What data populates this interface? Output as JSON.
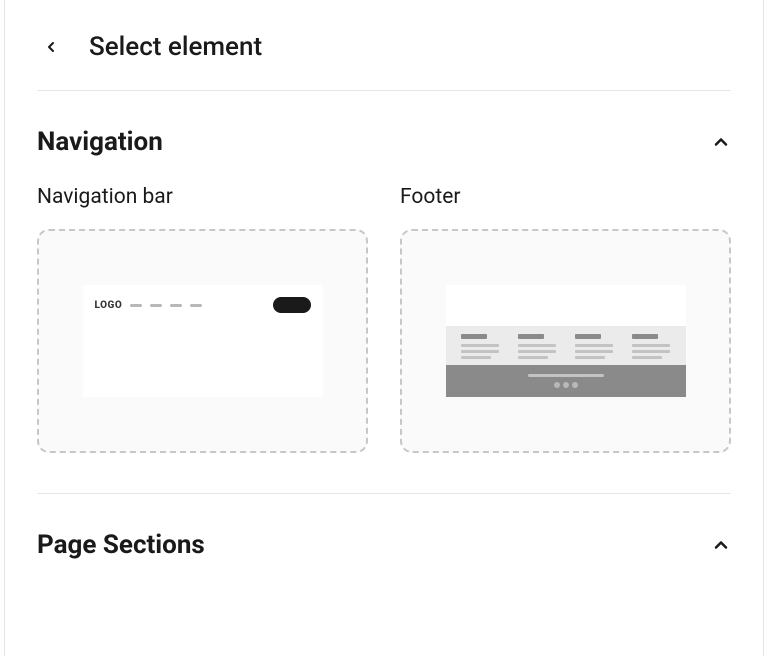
{
  "header": {
    "title": "Select element"
  },
  "sections": {
    "navigation": {
      "title": "Navigation",
      "expanded": true,
      "items": {
        "navbar": {
          "label": "Navigation bar",
          "logo_text": "LOGO"
        },
        "footer": {
          "label": "Footer"
        }
      }
    },
    "page_sections": {
      "title": "Page Sections",
      "expanded": true
    }
  }
}
